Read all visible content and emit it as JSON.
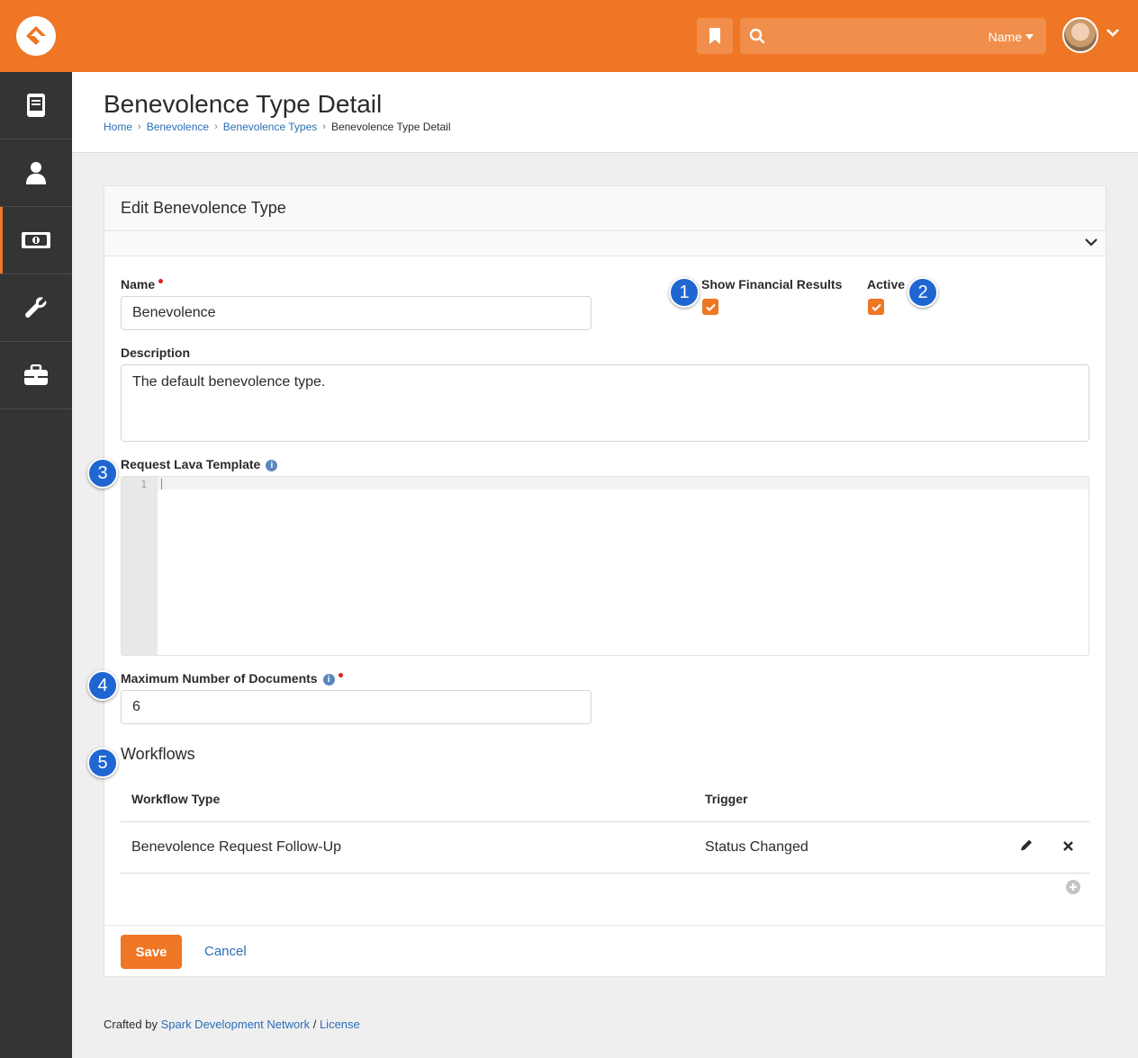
{
  "header": {
    "search_scope": "Name",
    "colors": {
      "brand": "#ee7624",
      "sidebar": "#343434",
      "link": "#2b6fb5",
      "badge": "#1f66d1"
    }
  },
  "sidebar": {
    "items": [
      {
        "icon": "book-icon"
      },
      {
        "icon": "person-icon"
      },
      {
        "icon": "money-icon",
        "active": true
      },
      {
        "icon": "wrench-icon"
      },
      {
        "icon": "briefcase-icon"
      }
    ]
  },
  "page": {
    "title": "Benevolence Type Detail",
    "breadcrumb": [
      "Home",
      "Benevolence",
      "Benevolence Types",
      "Benevolence Type Detail"
    ]
  },
  "panel": {
    "title": "Edit Benevolence Type",
    "name_label": "Name",
    "name_value": "Benevolence",
    "show_financial_label": "Show Financial Results",
    "show_financial_checked": true,
    "active_label": "Active",
    "active_checked": true,
    "description_label": "Description",
    "description_value": "The default benevolence type.",
    "lava_label": "Request Lava Template",
    "lava_line_number": "1",
    "max_docs_label": "Maximum Number of Documents",
    "max_docs_value": "6",
    "workflows_title": "Workflows",
    "workflows": {
      "columns": [
        "Workflow Type",
        "Trigger"
      ],
      "rows": [
        {
          "type": "Benevolence Request Follow-Up",
          "trigger": "Status Changed"
        }
      ]
    },
    "save_label": "Save",
    "cancel_label": "Cancel"
  },
  "callouts": [
    "1",
    "2",
    "3",
    "4",
    "5"
  ],
  "footer": {
    "prefix": "Crafted by",
    "org_link": "Spark Development Network",
    "separator": "/",
    "license_link": "License"
  }
}
